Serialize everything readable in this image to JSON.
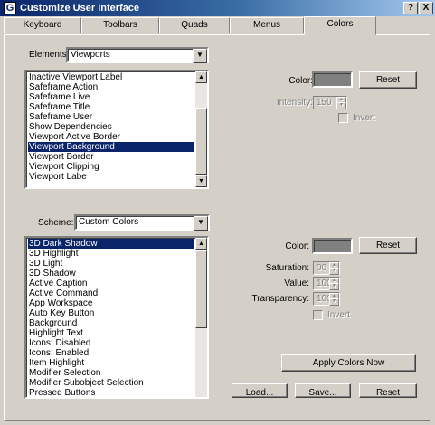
{
  "window": {
    "title": "Customize User Interface",
    "app_icon": "app-icon",
    "help_label": "?",
    "close_label": "X"
  },
  "tabs": [
    "Keyboard",
    "Toolbars",
    "Quads",
    "Menus",
    "Colors"
  ],
  "active_tab": "Colors",
  "elements": {
    "label": "Elements:",
    "value": "Viewports",
    "items": [
      "Inactive Viewport Label",
      "Safeframe Action",
      "Safeframe Live",
      "Safeframe Title",
      "Safeframe User",
      "Show Dependencies",
      "Viewport Active Border",
      "Viewport Background",
      "Viewport Border",
      "Viewport Clipping",
      "Viewport Labe"
    ],
    "selected": "Viewport Background"
  },
  "element_props": {
    "color_label": "Color:",
    "swatch_color": "#808080",
    "reset_label": "Reset",
    "intensity_label": "Intensity:",
    "intensity_value": "150",
    "invert_label": "Invert"
  },
  "scheme": {
    "label": "Scheme:",
    "value": "Custom Colors",
    "items": [
      "3D Dark Shadow",
      "3D Highlight",
      "3D Light",
      "3D Shadow",
      "Active Caption",
      "Active Command",
      "App Workspace",
      "Auto Key Button",
      "Background",
      "Highlight Text",
      "Icons: Disabled",
      "Icons: Enabled",
      "Item Highlight",
      "Modifier Selection",
      "Modifier Subobject Selection",
      "Pressed Buttons"
    ],
    "selected": "3D Dark Shadow"
  },
  "scheme_props": {
    "color_label": "Color:",
    "swatch_color": "#808080",
    "reset_label": "Reset",
    "saturation_label": "Saturation:",
    "saturation_value": "00",
    "value_label": "Value:",
    "value_value": "100",
    "transparency_label": "Transparency:",
    "transparency_value": "100",
    "invert_label": "Invert"
  },
  "buttons": {
    "apply": "Apply Colors Now",
    "load": "Load...",
    "save": "Save...",
    "reset": "Reset"
  },
  "colors": {
    "title_bar": "#0a246a",
    "selection": "#0a246a",
    "face": "#d4d0c8"
  }
}
